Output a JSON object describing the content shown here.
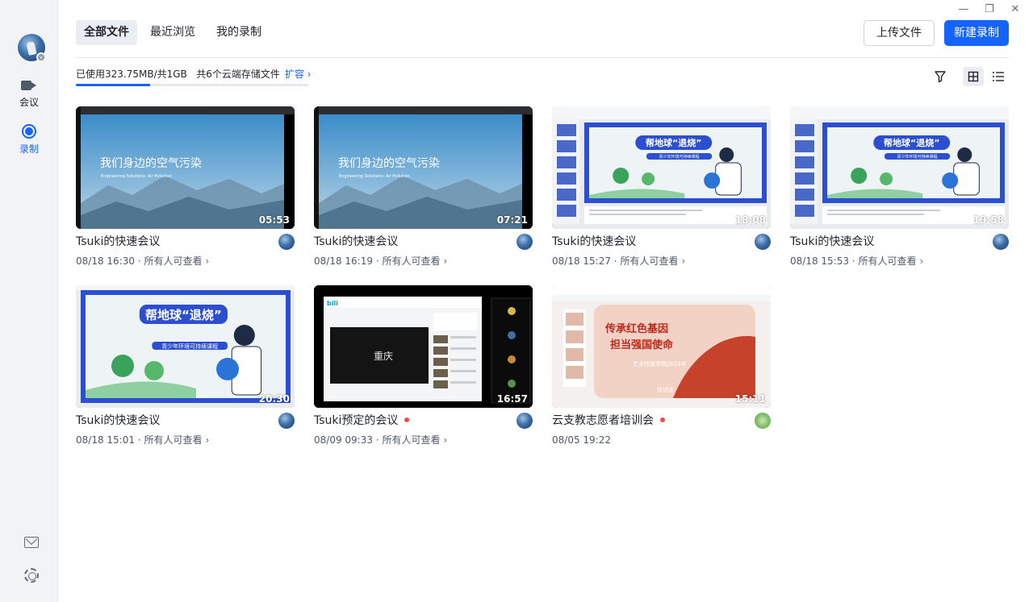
{
  "window": {
    "minimize": "—",
    "restore": "❐",
    "close": "✕"
  },
  "sidebar": {
    "items": [
      {
        "label": "会议",
        "icon": "video-camera-icon"
      },
      {
        "label": "录制",
        "icon": "record-icon",
        "active": true
      }
    ],
    "bottom": [
      {
        "icon": "mail-icon"
      },
      {
        "icon": "settings-gear-icon"
      }
    ]
  },
  "header": {
    "tabs": [
      {
        "label": "全部文件",
        "active": true
      },
      {
        "label": "最近浏览"
      },
      {
        "label": "我的录制"
      }
    ],
    "upload_label": "上传文件",
    "new_record_label": "新建录制"
  },
  "storage": {
    "text": "已使用323.75MB/共1GB   共6个云端存储文件",
    "expand_label": "扩容",
    "used_fraction": 0.32
  },
  "toolbar": {
    "filter_icon": "filter-icon",
    "grid_icon": "grid-view-icon",
    "list_icon": "list-view-icon"
  },
  "cards": [
    {
      "title": "Tsuki的快速会议",
      "duration": "05:53",
      "date": "08/18 16:30",
      "visibility": "所有人可查看",
      "thumb": "air",
      "slide_title": "我们身边的空气污染",
      "slide_sub": "Engineering Solutions: Air Pollution"
    },
    {
      "title": "Tsuki的快速会议",
      "duration": "07:21",
      "date": "08/18 16:19",
      "visibility": "所有人可查看",
      "thumb": "air",
      "slide_title": "我们身边的空气污染",
      "slide_sub": "Engineering Solutions: Air Pollution"
    },
    {
      "title": "Tsuki的快速会议",
      "duration": "18:08",
      "date": "08/18 15:27",
      "visibility": "所有人可查看",
      "thumb": "earth-ppt",
      "slide_title": "帮地球“退烧”",
      "slide_sub": "青少年环境可持续课程"
    },
    {
      "title": "Tsuki的快速会议",
      "duration": "19:58",
      "date": "08/18 15:53",
      "visibility": "所有人可查看",
      "thumb": "earth-ppt",
      "slide_title": "帮地球“退烧”",
      "slide_sub": "青少年环境可持续课程"
    },
    {
      "title": "Tsuki的快速会议",
      "duration": "20:30",
      "date": "08/18 15:01",
      "visibility": "所有人可查看",
      "thumb": "earth",
      "slide_title": "帮地球“退烧”",
      "slide_sub": "青少年环境可持续课程"
    },
    {
      "title": "Tsuki预定的会议",
      "duration": "16:57",
      "date": "08/09 09:33",
      "visibility": "所有人可查看",
      "thumb": "bili",
      "new": true
    },
    {
      "title": "云支教志愿者培训会",
      "duration": "15:11",
      "date": "08/05 19:22",
      "visibility": "",
      "thumb": "red",
      "new": true,
      "avatar": "green",
      "slide_title": "传承红色基因",
      "slide_line2": "担当强国使命",
      "slide_line3": "艺术传媒学院2024年",
      "slide_line4": "培训会"
    }
  ]
}
